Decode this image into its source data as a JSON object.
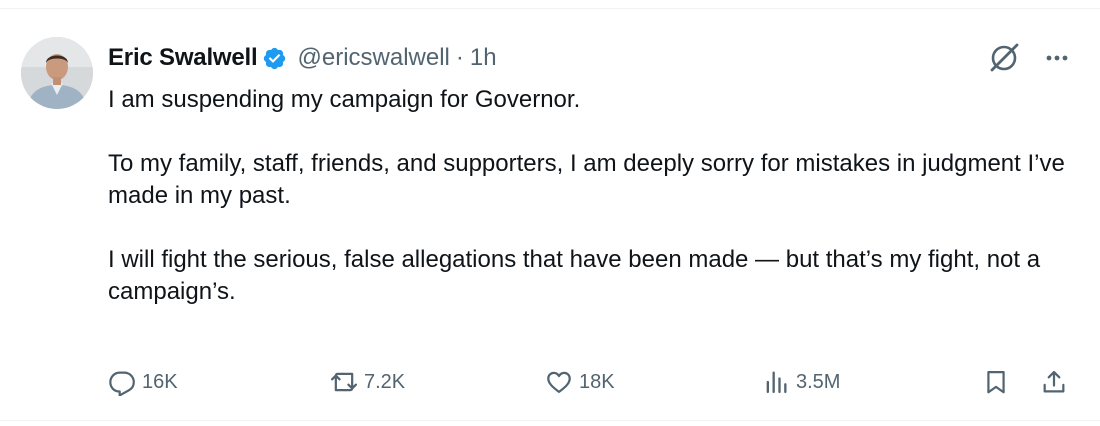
{
  "author": {
    "name": "Eric Swalwell",
    "handle": "@ericswalwell",
    "separator": "·",
    "time": "1h",
    "verified_color": "#1d9bf0"
  },
  "tweet": {
    "paragraphs": [
      "I am suspending my campaign for Governor.",
      "To my family, staff, friends, and supporters, I am deeply sorry for mistakes in judgment I’ve made in my past.",
      "I will fight the serious, false allegations that have been made — but that’s my fight, not a campaign’s."
    ]
  },
  "actions": {
    "replies": "16K",
    "reposts": "7.2K",
    "likes": "18K",
    "views": "3.5M"
  },
  "icons": {
    "top": [
      "grok-icon",
      "more-icon"
    ],
    "bar": [
      "reply-icon",
      "repost-icon",
      "like-icon",
      "views-icon",
      "bookmark-icon",
      "share-icon"
    ]
  },
  "colors": {
    "text": "#0f1419",
    "secondary": "#536471",
    "divider": "#eff3f4"
  }
}
